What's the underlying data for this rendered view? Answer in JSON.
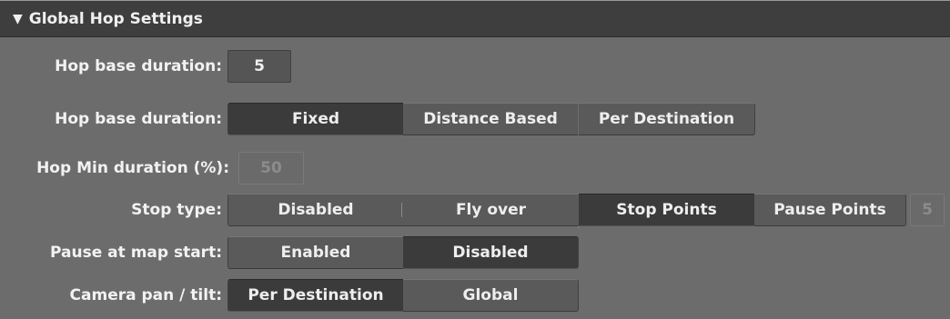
{
  "header": {
    "title": "Global Hop Settings",
    "toggle_glyph": "▼"
  },
  "rows": {
    "hop_base_duration_value": {
      "label": "Hop base duration:",
      "value": "5"
    },
    "hop_base_duration_mode": {
      "label": "Hop base duration:",
      "options": [
        "Fixed",
        "Distance Based",
        "Per Destination"
      ],
      "selected": "Fixed"
    },
    "hop_min_duration": {
      "label": "Hop Min duration (%):",
      "value": "50",
      "disabled": true
    },
    "stop_type": {
      "label": "Stop type:",
      "options": [
        "Disabled",
        "Fly over",
        "Stop Points",
        "Pause Points"
      ],
      "selected": "Stop Points",
      "extra_value": "5"
    },
    "pause_at_map_start": {
      "label": "Pause at map start:",
      "options": [
        "Enabled",
        "Disabled"
      ],
      "selected": "Disabled"
    },
    "camera_pan_tilt": {
      "label": "Camera pan / tilt:",
      "options": [
        "Per Destination",
        "Global"
      ],
      "selected": "Per Destination"
    }
  }
}
